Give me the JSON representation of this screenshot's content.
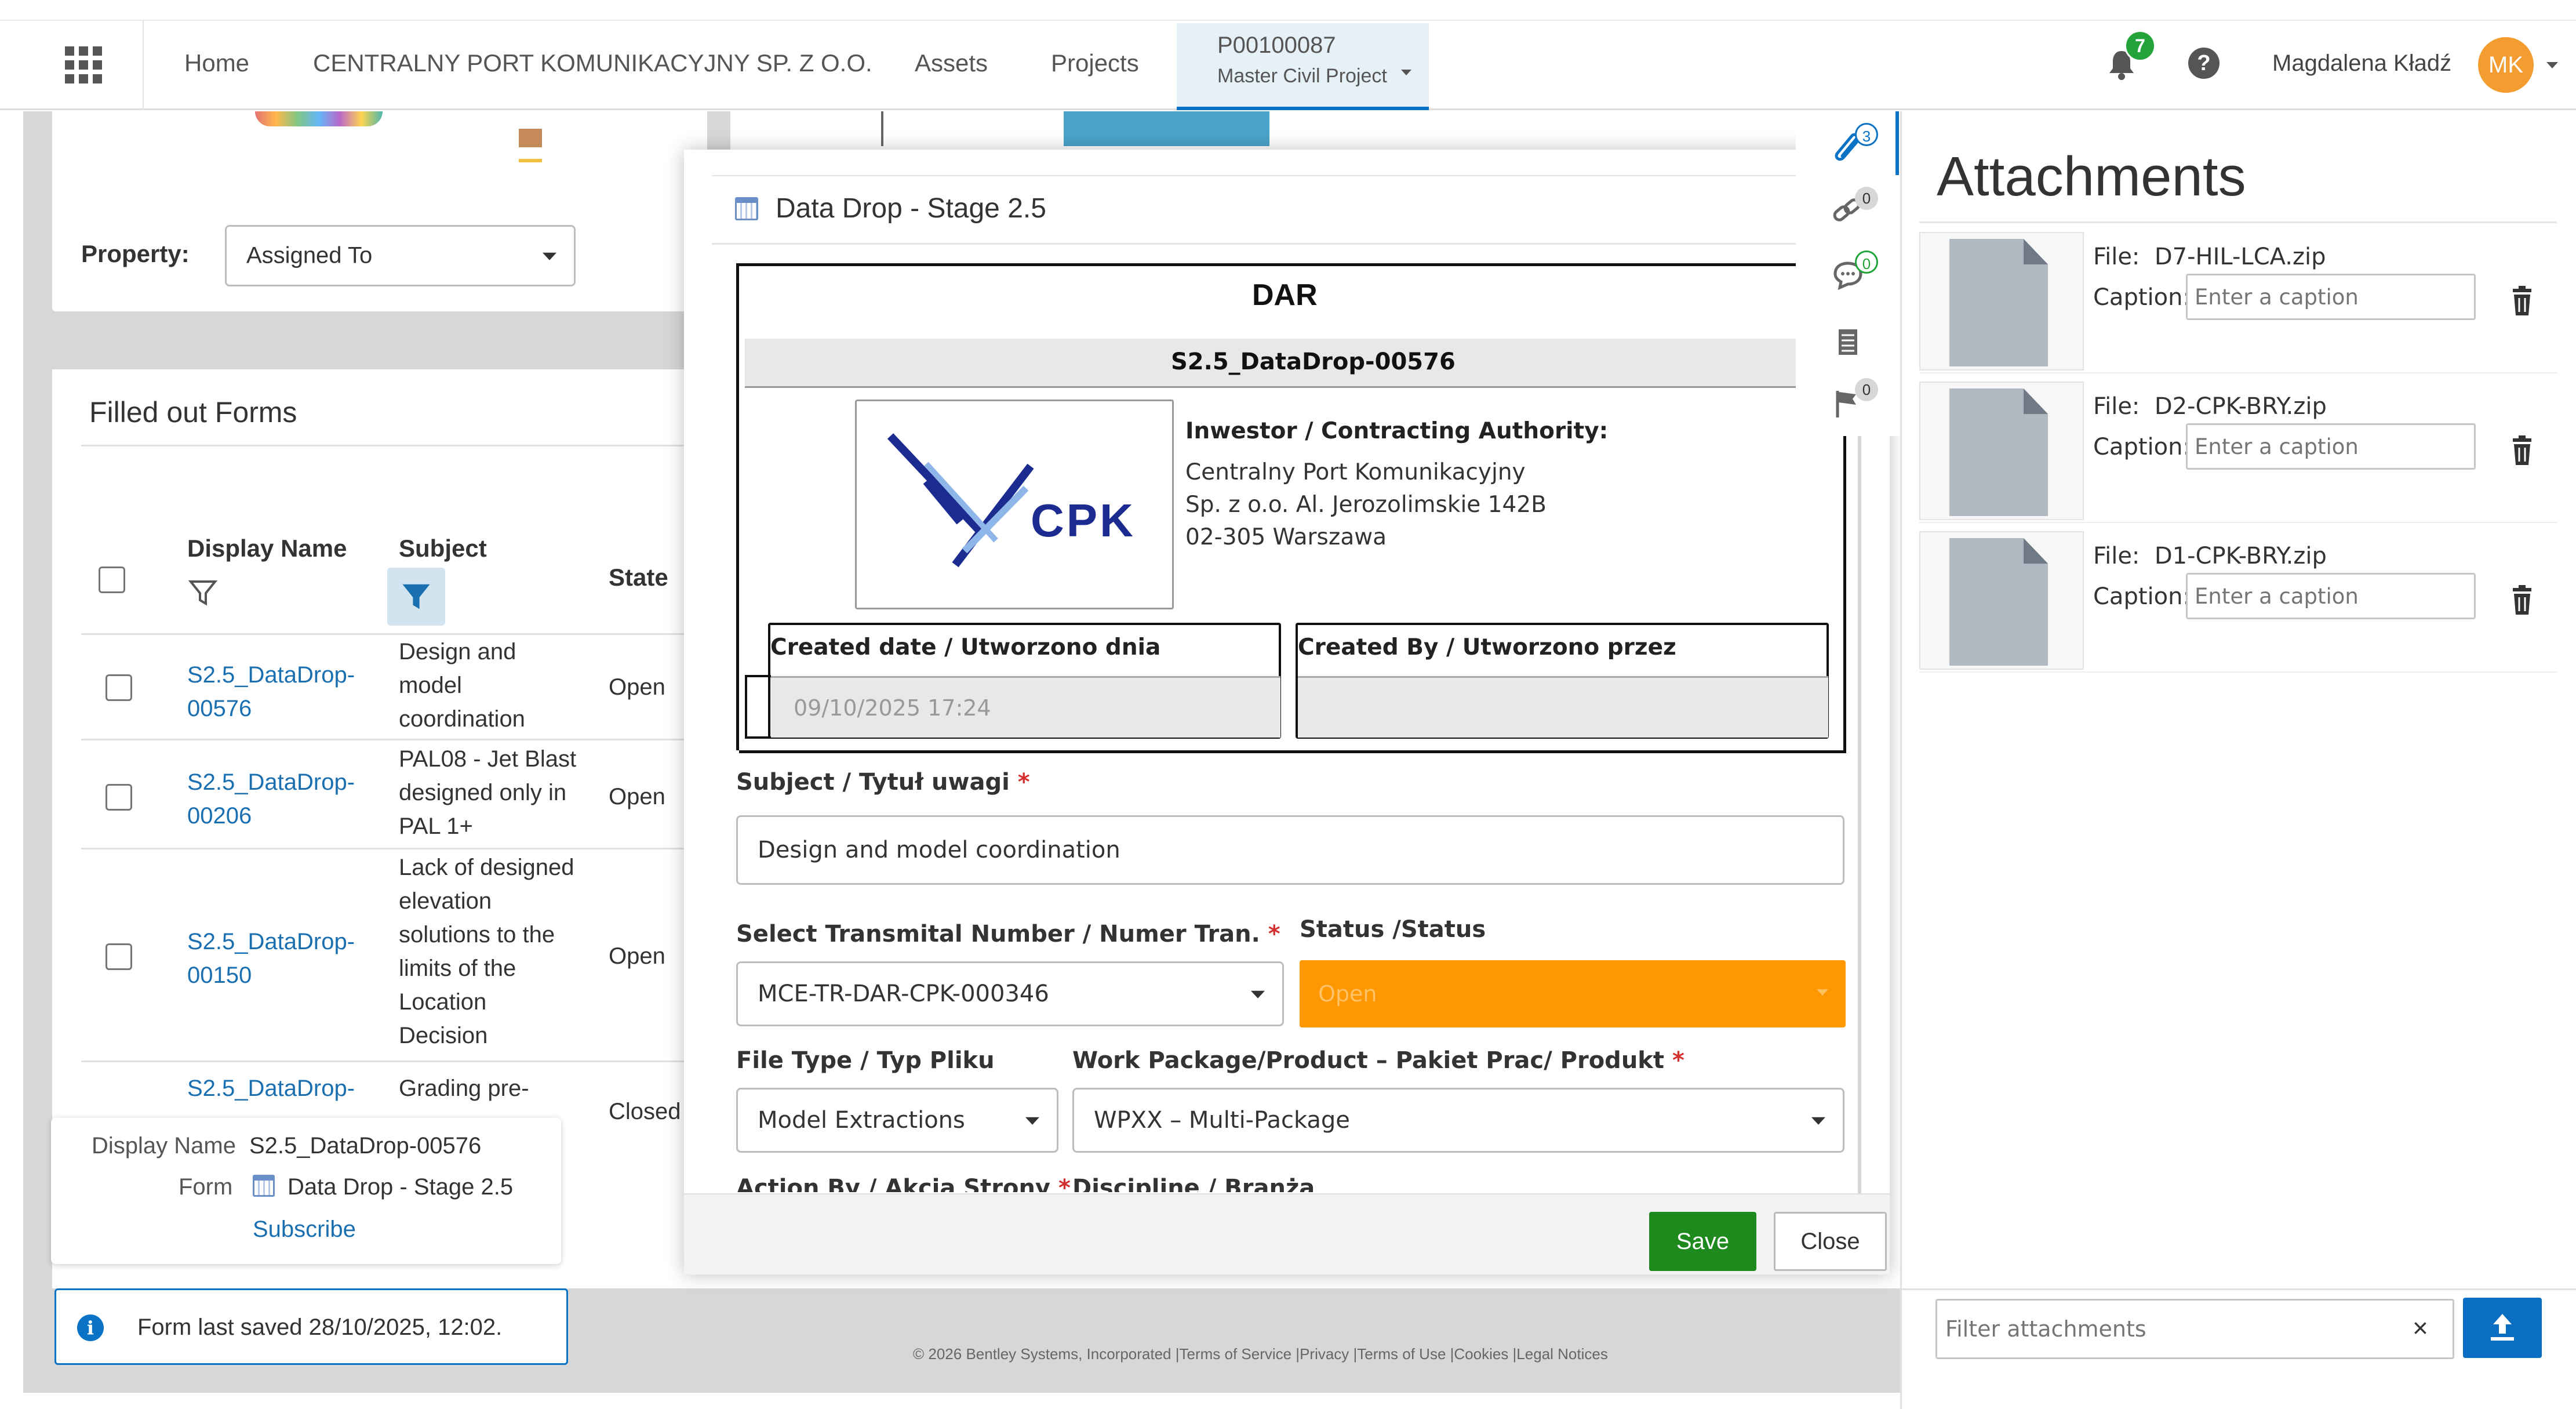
{
  "header": {
    "nav": [
      "Home",
      "CENTRALNY PORT KOMUNIKACYJNY SP. Z O.O.",
      "Assets",
      "Projects"
    ],
    "project_code": "P00100087",
    "project_name": "Master Civil Project",
    "notifications_count": "7",
    "user_name": "Magdalena Kładź",
    "user_initials": "MK"
  },
  "background": {
    "property_label": "Property:",
    "property_value": "Assigned To",
    "forms_title": "Filled out Forms",
    "columns": [
      "Display Name",
      "Subject",
      "State"
    ],
    "rows": [
      {
        "name": [
          "S2.5_DataDrop-",
          "00576"
        ],
        "subject": [
          "Design and",
          "model",
          "coordination"
        ],
        "state": "Open"
      },
      {
        "name": [
          "S2.5_DataDrop-",
          "00206"
        ],
        "subject": [
          "PAL08 - Jet Blast",
          "designed only in",
          "PAL 1+"
        ],
        "state": "Open"
      },
      {
        "name": [
          "S2.5_DataDrop-",
          "00150"
        ],
        "subject": [
          "Lack of designed",
          "elevation",
          "solutions to the",
          "limits of the",
          "Location",
          "Decision"
        ],
        "state": "Open"
      },
      {
        "name": [
          "S2.5_DataDrop-"
        ],
        "subject": [
          "Grading pre-"
        ],
        "state": "Closed"
      }
    ],
    "footer": "© 2026 Bentley Systems, Incorporated |Terms of Service |Privacy |Terms of Use |Cookies |Legal Notices"
  },
  "tooltip": {
    "display_name_label": "Display Name",
    "display_name_value": "S2.5_DataDrop-00576",
    "form_label": "Form",
    "form_value": "Data Drop - Stage 2.5",
    "subscribe": "Subscribe"
  },
  "toast": {
    "text": "Form last saved 28/10/2025, 12:02."
  },
  "modal": {
    "title": "Data Drop - Stage 2.5",
    "dar": "DAR",
    "doc_id": "S2.5_DataDrop-00576",
    "logo_text": "CPK",
    "investor_label": "Inwestor / Contracting Authority:",
    "investor_lines": [
      "Centralny Port Komunikacyjny",
      "Sp. z o.o. Al. Jerozolimskie 142B",
      "02-305 Warszawa"
    ],
    "created_date_label": "Created date / Utworzono dnia",
    "created_date_value": "09/10/2025 17:24",
    "created_by_label": "Created By / Utworzono przez",
    "subject_label": "Subject / Tytuł uwagi",
    "subject_value": "Design and model coordination",
    "transmittal_label": "Select Transmital Number / Numer Tran.",
    "transmittal_value": "MCE-TR-DAR-CPK-000346",
    "status_label": "Status /Status",
    "status_value": "Open",
    "status_color": "#ff9800",
    "filetype_label": "File Type / Typ Pliku",
    "filetype_value": "Model Extractions",
    "workpackage_label": "Work Package/Product – Pakiet Prac/ Produkt",
    "workpackage_value": "WPXX – Multi-Package",
    "actionby_label": "Action By / Akcja Strony",
    "discipline_label": "Discipline / Branża",
    "save": "Save",
    "close": "Close",
    "save_color": "#1e8a1e"
  },
  "side_tabs": [
    {
      "icon": "paperclip-icon",
      "count": "3"
    },
    {
      "icon": "link-icon",
      "count": "0"
    },
    {
      "icon": "comment-icon",
      "count": "0"
    },
    {
      "icon": "document-list-icon",
      "count": ""
    },
    {
      "icon": "flag-icon",
      "count": "0"
    }
  ],
  "attachments": {
    "title": "Attachments",
    "file_label": "File:",
    "caption_label": "Caption:",
    "caption_placeholder": "Enter a caption",
    "files": [
      "D7-HIL-LCA.zip",
      "D2-CPK-BRY.zip",
      "D1-CPK-BRY.zip"
    ],
    "filter_placeholder": "Filter attachments",
    "accent_color": "#0a6fc2"
  }
}
